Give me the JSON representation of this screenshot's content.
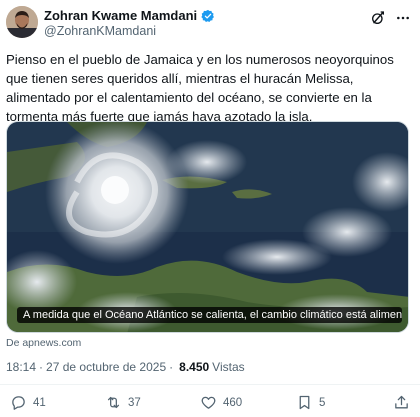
{
  "author": {
    "display_name": "Zohran Kwame Mamdani",
    "handle": "@ZohranKMamdani",
    "verified_color": "#1d9bf0"
  },
  "tweet": {
    "text": "Pienso en el pueblo de Jamaica y en los numerosos neoyorquinos que tienen seres queridos allí, mientras el huracán Melissa, alimentado por el calentamiento del océano, se convierte en la tormenta más fuerte que jamás haya azotado la isla."
  },
  "media": {
    "caption": "A medida que el Océano Atlántico se calienta, el cambio climático está alimentando la...",
    "source": "De apnews.com"
  },
  "meta": {
    "time": "18:14",
    "date": "27 de octubre de 2025",
    "views_count": "8.450",
    "views_label": "Vistas"
  },
  "actions": {
    "replies": "41",
    "reposts": "37",
    "likes": "460",
    "bookmarks": "5"
  },
  "icons": {
    "verified": "verified-badge-icon",
    "grok": "grok-icon",
    "more": "more-icon",
    "reply": "reply-icon",
    "repost": "repost-icon",
    "like": "heart-icon",
    "bookmark": "bookmark-icon",
    "share": "share-icon"
  },
  "colors": {
    "text_primary": "#0f1419",
    "text_secondary": "#536471",
    "accent": "#1d9bf0"
  }
}
